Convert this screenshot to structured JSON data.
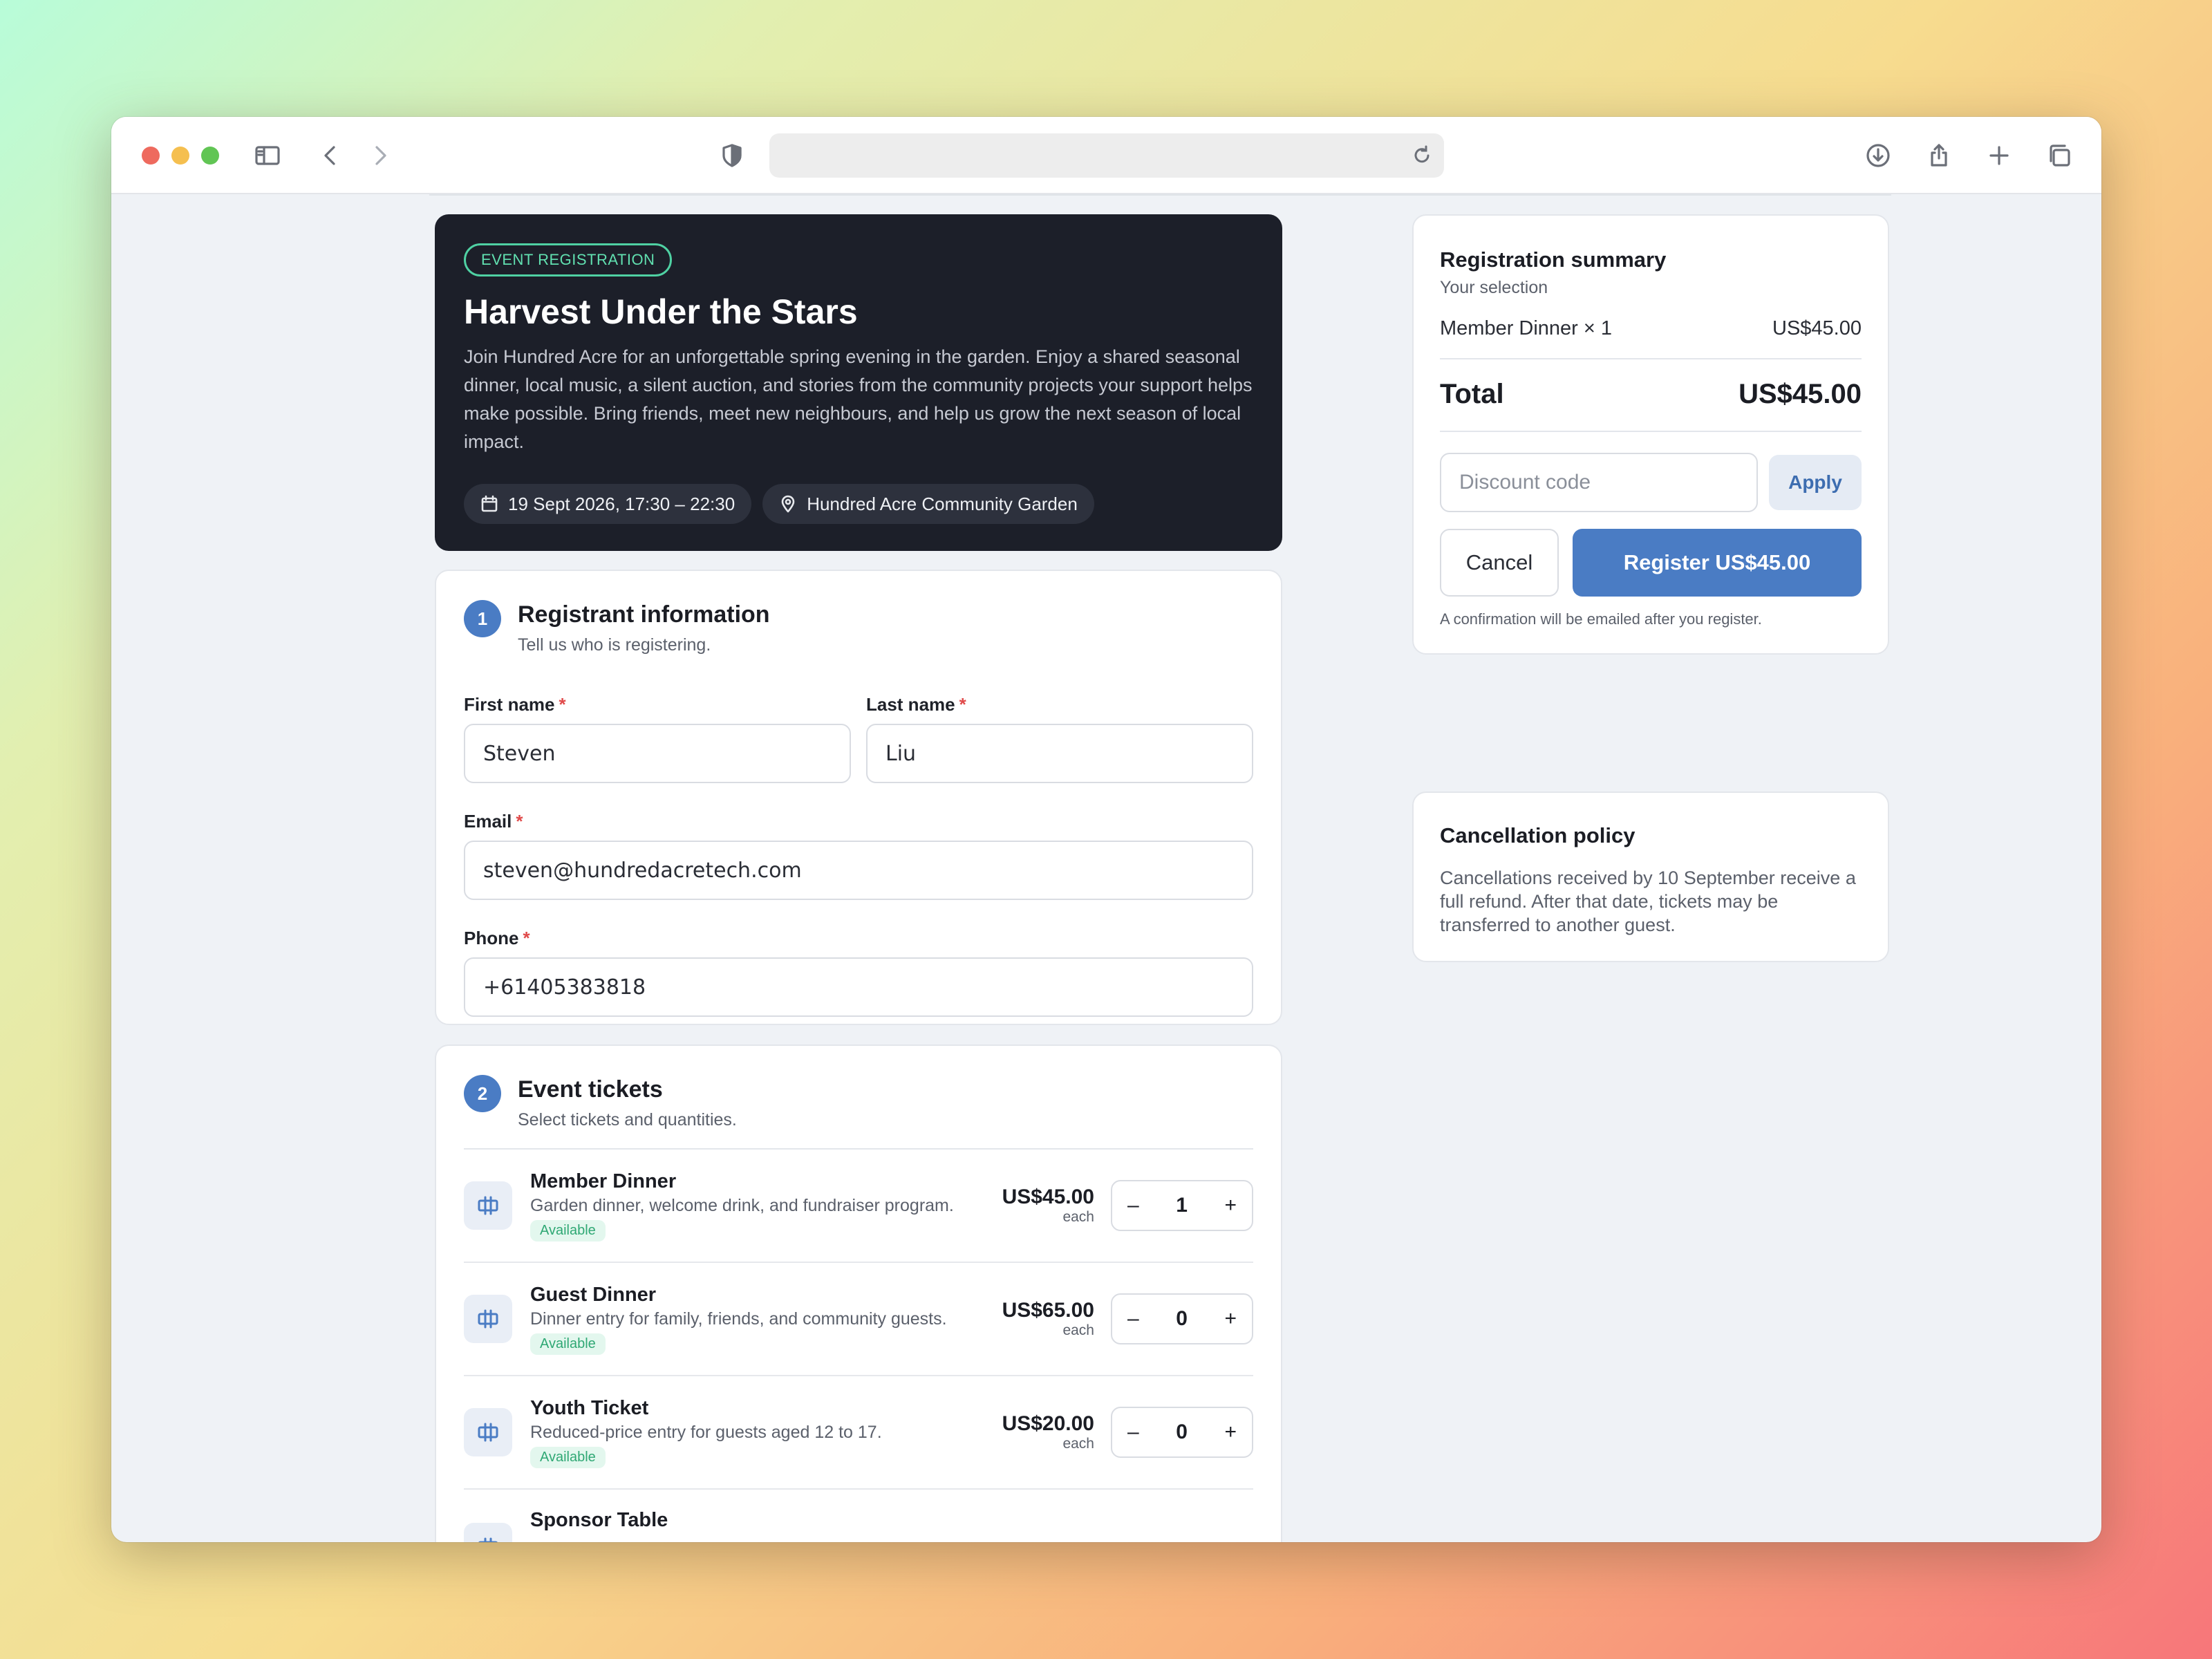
{
  "browser": {
    "address": "",
    "icons": [
      "sidebar-icon",
      "back-icon",
      "forward-icon",
      "shield-icon",
      "reload-icon",
      "download-icon",
      "share-icon",
      "new-tab-icon",
      "tabs-overview-icon"
    ]
  },
  "hero": {
    "badge": "EVENT REGISTRATION",
    "title": "Harvest Under the Stars",
    "description": "Join Hundred Acre for an unforgettable spring evening in the garden. Enjoy a shared seasonal dinner, local music, a silent auction, and stories from the community projects your support helps make possible. Bring friends, meet new neighbours, and help us grow the next season of local impact.",
    "date": "19 Sept 2026, 17:30 – 22:30",
    "location": "Hundred Acre Community Garden"
  },
  "registrant": {
    "step": "1",
    "title": "Registrant information",
    "subtitle": "Tell us who is registering.",
    "first_name_label": "First name",
    "first_name": "Steven",
    "last_name_label": "Last name",
    "last_name": "Liu",
    "email_label": "Email",
    "email": "steven@hundredacretech.com",
    "phone_label": "Phone",
    "phone": "+61405383818",
    "required_mark": "*"
  },
  "tickets": {
    "step": "2",
    "title": "Event tickets",
    "subtitle": "Select tickets and quantities.",
    "each_label": "each",
    "items": [
      {
        "name": "Member Dinner",
        "description": "Garden dinner, welcome drink, and fundraiser program.",
        "status": "Available",
        "price": "US$45.00",
        "qty": "1"
      },
      {
        "name": "Guest Dinner",
        "description": "Dinner entry for family, friends, and community guests.",
        "status": "Available",
        "price": "US$65.00",
        "qty": "0"
      },
      {
        "name": "Youth Ticket",
        "description": "Reduced-price entry for guests aged 12 to 17.",
        "status": "Available",
        "price": "US$20.00",
        "qty": "0"
      },
      {
        "name": "Sponsor Table",
        "description": "",
        "status": "",
        "price": "",
        "qty": ""
      }
    ],
    "minus": "–",
    "plus": "+"
  },
  "summary": {
    "title": "Registration summary",
    "subtitle": "Your selection",
    "line_item": "Member Dinner × 1",
    "line_price": "US$45.00",
    "total_label": "Total",
    "total_value": "US$45.00",
    "discount_placeholder": "Discount code",
    "apply_label": "Apply",
    "cancel_label": "Cancel",
    "register_label": "Register US$45.00",
    "confirmation_note": "A confirmation will be emailed after you register."
  },
  "policy": {
    "title": "Cancellation policy",
    "text": "Cancellations received by 10 September receive a full refund. After that date, tickets may be transferred to another guest."
  },
  "colors": {
    "accent": "#4a7cc4",
    "hero_bg": "#1c1f29",
    "available": "#2fa874",
    "required": "#e04a4a"
  }
}
